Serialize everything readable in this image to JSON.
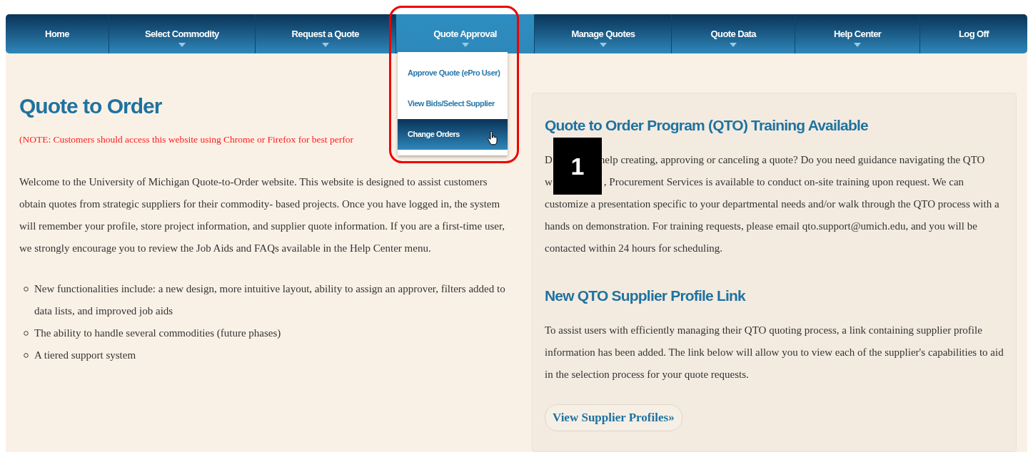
{
  "nav": {
    "items": [
      {
        "label": "Home",
        "has_menu": false,
        "selected": false
      },
      {
        "label": "Select Commodity",
        "has_menu": true,
        "selected": false
      },
      {
        "label": "Request a Quote",
        "has_menu": true,
        "selected": false
      },
      {
        "label": "Quote Approval",
        "has_menu": true,
        "selected": true
      },
      {
        "label": "Manage Quotes",
        "has_menu": true,
        "selected": false
      },
      {
        "label": "Quote Data",
        "has_menu": true,
        "selected": false
      },
      {
        "label": "Help Center",
        "has_menu": true,
        "selected": false
      },
      {
        "label": "Log Off",
        "has_menu": false,
        "selected": false
      }
    ]
  },
  "dropdown": {
    "items": [
      {
        "label": "Approve Quote (ePro User)",
        "selected": false
      },
      {
        "label": "View Bids/Select Supplier",
        "selected": false
      },
      {
        "label": "Change Orders",
        "selected": true
      }
    ]
  },
  "main": {
    "title": "Quote to Order",
    "note": "(NOTE: Customers should access this website using Chrome or Firefox for best perfor",
    "intro": "Welcome to the University of Michigan Quote-to-Order website. This website is designed to assist customers obtain quotes from strategic suppliers for their commodity- based projects. Once you have logged in, the system will remember your profile, store project information, and supplier quote information. If you are a first-time user, we strongly encourage you to review the Job Aids and FAQs available in the Help Center menu.",
    "bullets": [
      "New functionalities include: a new design, more intuitive layout, ability to assign an approver, filters added to data lists, and improved job aids",
      "The ability to handle several commodities (future phases)",
      "A tiered support system"
    ]
  },
  "sidebar": {
    "sections": [
      {
        "title": "Quote to Order Program (QTO) Training Available",
        "fragments": [
          "D",
          "help creating, approving or canceling a quote? Do you need guidance navigating the QTO",
          "w",
          ", Procurement Services is available to conduct on-site training upon request. We can",
          "customize a presentation specific to your departmental needs and/or walk through the QTO process with a hands on demonstration. For training requests, please email qto.support@umich.edu, and you will be contacted within 24 hours for scheduling."
        ]
      },
      {
        "title": "New QTO Supplier Profile Link",
        "text": "To assist users with efficiently managing their QTO quoting process, a link containing supplier profile information has been added. The link below will allow you to view each of the supplier's capabilities to aid in the selection process for your quote requests."
      }
    ],
    "button": "View Supplier Profiles»"
  },
  "annotation": {
    "badge": "1"
  }
}
